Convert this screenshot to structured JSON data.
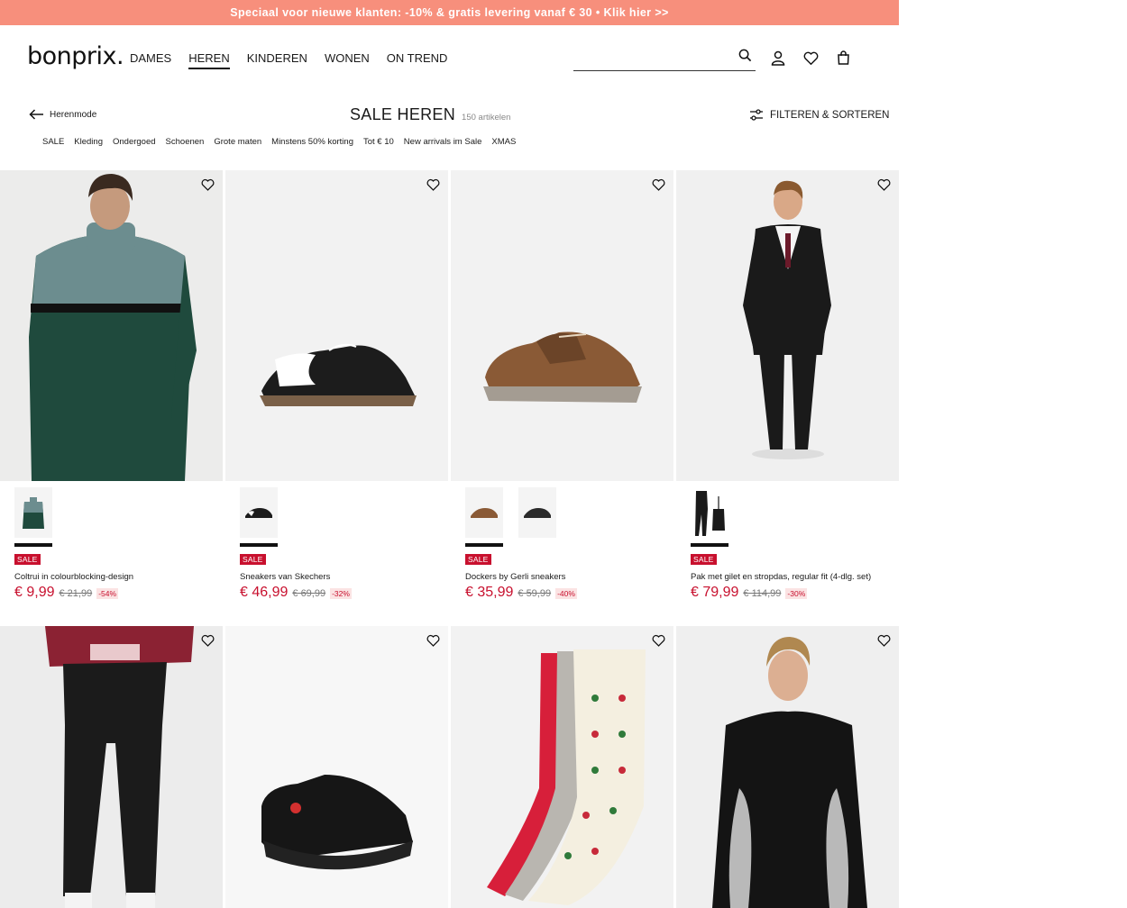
{
  "promo_banner": {
    "text": "Speciaal voor nieuwe klanten: -10% & gratis levering vanaf € 30 • Klik hier >>"
  },
  "header": {
    "logo": "bonprix.",
    "nav": [
      {
        "label": "DAMES",
        "active": false
      },
      {
        "label": "HEREN",
        "active": true
      },
      {
        "label": "KINDEREN",
        "active": false
      },
      {
        "label": "WONEN",
        "active": false
      },
      {
        "label": "ON TREND",
        "active": false
      }
    ],
    "search": {
      "value": "",
      "placeholder": ""
    },
    "icons": [
      "search-icon",
      "account-icon",
      "wishlist-icon",
      "bag-icon"
    ]
  },
  "page": {
    "back_label": "Herenmode",
    "title": "SALE HEREN",
    "count": "150 artikelen",
    "filter_label": "FILTEREN & SORTEREN",
    "subcategories": [
      "SALE",
      "Kleding",
      "Ondergoed",
      "Schoenen",
      "Grote maten",
      "Minstens 50% korting",
      "Tot € 10",
      "New arrivals im Sale",
      "XMAS"
    ]
  },
  "products": [
    {
      "name": "Coltrui in colourblocking-design",
      "badge": "SALE",
      "price": "€ 9,99",
      "old_price": "€ 21,99",
      "discount": "-54%",
      "swatches": 1
    },
    {
      "name": "Sneakers van Skechers",
      "badge": "SALE",
      "price": "€ 46,99",
      "old_price": "€ 69,99",
      "discount": "-32%",
      "swatches": 1
    },
    {
      "name": "Dockers by Gerli sneakers",
      "badge": "SALE",
      "price": "€ 35,99",
      "old_price": "€ 59,99",
      "discount": "-40%",
      "swatches": 2
    },
    {
      "name": "Pak met gilet en stropdas, regular fit (4-dlg. set)",
      "badge": "SALE",
      "price": "€ 79,99",
      "old_price": "€ 114,99",
      "discount": "-30%",
      "swatches": 1
    },
    {
      "name": "",
      "badge": "",
      "price": "",
      "old_price": "",
      "discount": ""
    },
    {
      "name": "",
      "badge": "",
      "price": "",
      "old_price": "",
      "discount": ""
    },
    {
      "name": "",
      "badge": "",
      "price": "",
      "old_price": "",
      "discount": ""
    },
    {
      "name": "",
      "badge": "",
      "price": "",
      "old_price": "",
      "discount": ""
    }
  ],
  "colors": {
    "accent": "#c8102e",
    "promo": "#f78f7c",
    "text": "#1a1a1a"
  }
}
